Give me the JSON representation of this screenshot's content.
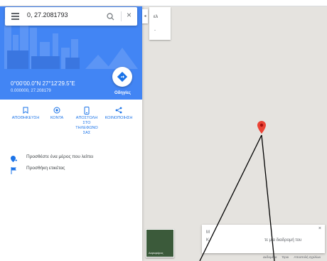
{
  "search": {
    "query": "0, 27.2081793"
  },
  "place": {
    "coords_dms": "0°00'00.0\"N 27°12'29.5\"E",
    "coords_decimal": "0.000000, 27.208179",
    "directions_label": "Οδηγίες"
  },
  "actions": [
    {
      "label": "ΑΠΟΘΗΚΕΥΣΗ",
      "icon": "bookmark-icon"
    },
    {
      "label": "ΚΟΝΤΑ",
      "icon": "nearby-icon"
    },
    {
      "label": "ΑΠΟΣΤΟΛΗ ΣΤΟ ΤΗΛΕΦΩΝΟ ΣΑΣ",
      "icon": "phone-icon"
    },
    {
      "label": "ΚΟΙΝΟΠΟΙΗΣΗ",
      "icon": "share-icon"
    }
  ],
  "links": [
    {
      "label": "Προσθέστε ένα μέρος που λείπει",
      "icon": "add-place-icon"
    },
    {
      "label": "Προσθήκη ετικέτας",
      "icon": "flag-icon"
    }
  ],
  "map": {
    "layer_label": "ελ",
    "layer_sub": "-",
    "thumb_label": "Δορυφόρος",
    "info_line1": "Μ",
    "info_line2": "Κ",
    "info_tail": "τε μια διαδρομή του",
    "footer": [
      "Δεδομένα",
      "Όροι",
      "Αποστολή σχολίων"
    ]
  },
  "colors": {
    "header_blue": "#4285f4",
    "pin_red": "#ea4335",
    "action_blue": "#1a73e8"
  }
}
